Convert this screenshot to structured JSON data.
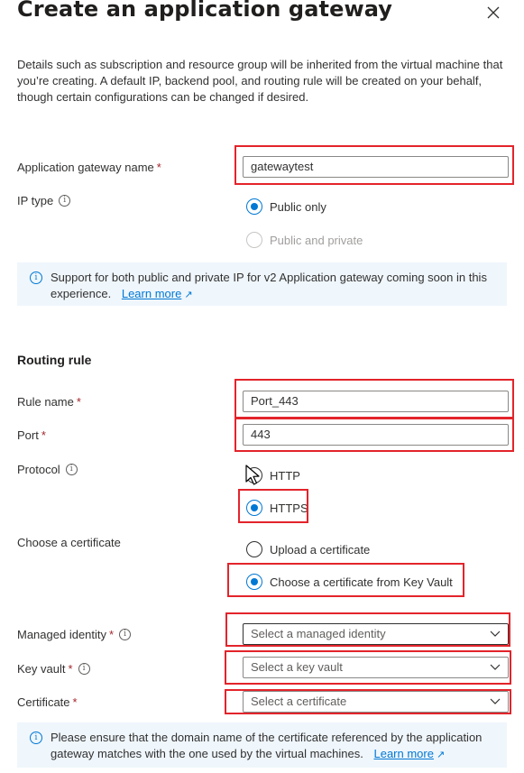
{
  "header": {
    "title": "Create an application gateway"
  },
  "description": "Details such as subscription and resource group will be inherited from the virtual machine that you’re creating. A default IP, backend pool, and routing rule will be created on your behalf, though certain configurations can be changed if desired.",
  "gateway": {
    "name_label": "Application gateway name",
    "name_value": "gatewaytest",
    "ip_type_label": "IP type",
    "ip_options": [
      "Public only",
      "Public and private"
    ],
    "ip_selected": "Public only",
    "info_text": "Support for both public and private IP for v2 Application gateway coming soon in this experience.",
    "info_link": "Learn more"
  },
  "routing": {
    "section_title": "Routing rule",
    "rule_name_label": "Rule name",
    "rule_name_value": "Port_443",
    "port_label": "Port",
    "port_value": "443",
    "protocol_label": "Protocol",
    "protocol_options": [
      "HTTP",
      "HTTPS"
    ],
    "protocol_selected": "HTTPS",
    "cert_choice_label": "Choose a certificate",
    "cert_options": [
      "Upload a certificate",
      "Choose a certificate from Key Vault"
    ],
    "cert_selected": "Choose a certificate from Key Vault",
    "managed_identity_label": "Managed identity",
    "managed_identity_placeholder": "Select a managed identity",
    "key_vault_label": "Key vault",
    "key_vault_placeholder": "Select a key vault",
    "certificate_label": "Certificate",
    "certificate_placeholder": "Select a certificate",
    "bottom_info_text": "Please ensure that the domain name of the certificate referenced by the application gateway matches with the one used by the virtual machines.",
    "bottom_info_link": "Learn more"
  },
  "required_marker": "*",
  "info_glyph": "i",
  "colors": {
    "accent": "#0078d4",
    "highlight": "#e3242b",
    "info_bg": "#eff6fc",
    "required": "#a4262c"
  },
  "icons": [
    "close-icon",
    "info-icon",
    "chevron-down-icon",
    "external-link-icon",
    "mouse-cursor-icon"
  ]
}
